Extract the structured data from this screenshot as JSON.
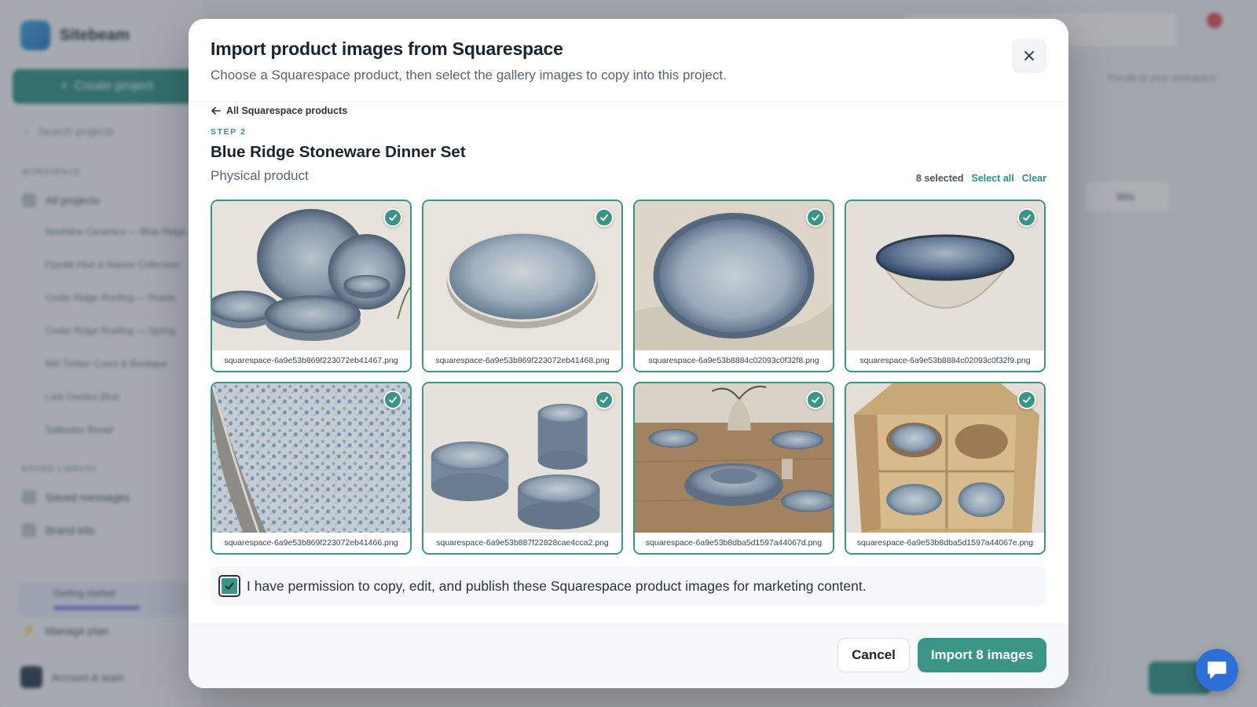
{
  "app": {
    "brand": "Sitebeam",
    "create_label": "Create project",
    "search_placeholder": "Search projects",
    "workspace_heading": "WORKSPACE",
    "all_projects": "All projects",
    "projects": [
      "Northline Ceramics — Blue Ridge",
      "Fjordlit Hive & Nature Collection",
      "Cedar Ridge Roofing — Prairie",
      "Cedar Ridge Roofing — Spring",
      "Mill Timber Coast & Boutique",
      "Lark Garden Blue",
      "Saltwater Bread"
    ],
    "brand_library_heading": "BRAND LIBRARY",
    "saved_messages": "Saved messages",
    "brand_kits": "Brand kits",
    "getting_started": "Getting started",
    "manage_plan": "Manage plan",
    "account": "Account & team",
    "private_note": "Private to your workspace",
    "card_label": "Wix"
  },
  "modal": {
    "title": "Import product images from Squarespace",
    "subtitle": "Choose a Squarespace product, then select the gallery images to copy into this project.",
    "back_label": "All Squarespace products",
    "step_label": "STEP 2",
    "product_name": "Blue Ridge Stoneware Dinner Set",
    "product_type": "Physical product",
    "selected_count": "8 selected",
    "select_all": "Select all",
    "clear": "Clear",
    "images": [
      {
        "file": "squarespace-6a9e53b869f223072eb41467.png",
        "scene": "stack-set",
        "selected": true
      },
      {
        "file": "squarespace-6a9e53b869f223072eb41468.png",
        "scene": "single-plate",
        "selected": true
      },
      {
        "file": "squarespace-6a9e53b8884c02093c0f32f8.png",
        "scene": "plate-linen",
        "selected": true
      },
      {
        "file": "squarespace-6a9e53b8884c02093c0f32f9.png",
        "scene": "bowl",
        "selected": true
      },
      {
        "file": "squarespace-6a9e53b869f223072eb41466.png",
        "scene": "closeup",
        "selected": true
      },
      {
        "file": "squarespace-6a9e53b887f22828cae4cca2.png",
        "scene": "stacks",
        "selected": true
      },
      {
        "file": "squarespace-6a9e53b8dba5d1597a44067d.png",
        "scene": "table",
        "selected": true
      },
      {
        "file": "squarespace-6a9e53b8dba5d1597a44067e.png",
        "scene": "box",
        "selected": true
      }
    ],
    "permission_text": "I have permission to copy, edit, and publish these Squarespace product images for marketing content.",
    "permission_checked": true,
    "cancel_label": "Cancel",
    "import_label": "Import 8 images"
  },
  "colors": {
    "accent": "#3a9586",
    "chat": "#2d6fd6"
  }
}
